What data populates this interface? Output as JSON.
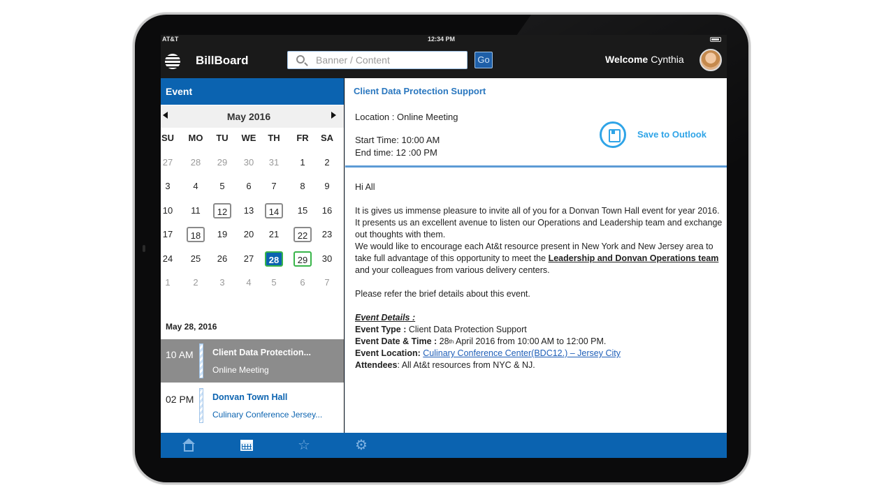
{
  "status_bar": {
    "carrier": "AT&T",
    "time": "12:34 PM"
  },
  "header": {
    "brand": "BillBoard",
    "search_placeholder": "Banner / Content",
    "go_label": "Go",
    "welcome": "Welcome",
    "user_name": "Cynthia"
  },
  "left_panel": {
    "title": "Event",
    "month": "May 2016",
    "weekdays": [
      "SU",
      "MO",
      "TU",
      "WE",
      "TH",
      "FR",
      "SA"
    ],
    "weeks": [
      [
        {
          "d": "27",
          "s": "muted"
        },
        {
          "d": "28",
          "s": "muted"
        },
        {
          "d": "29",
          "s": "muted"
        },
        {
          "d": "30",
          "s": "muted"
        },
        {
          "d": "31",
          "s": "muted"
        },
        {
          "d": "1",
          "s": ""
        },
        {
          "d": "2",
          "s": ""
        }
      ],
      [
        {
          "d": "3",
          "s": ""
        },
        {
          "d": "4",
          "s": ""
        },
        {
          "d": "5",
          "s": ""
        },
        {
          "d": "6",
          "s": ""
        },
        {
          "d": "7",
          "s": ""
        },
        {
          "d": "8",
          "s": ""
        },
        {
          "d": "9",
          "s": ""
        }
      ],
      [
        {
          "d": "10",
          "s": ""
        },
        {
          "d": "11",
          "s": ""
        },
        {
          "d": "12",
          "s": "ev"
        },
        {
          "d": "13",
          "s": ""
        },
        {
          "d": "14",
          "s": "ev"
        },
        {
          "d": "15",
          "s": ""
        },
        {
          "d": "16",
          "s": ""
        }
      ],
      [
        {
          "d": "17",
          "s": ""
        },
        {
          "d": "18",
          "s": "ev"
        },
        {
          "d": "19",
          "s": ""
        },
        {
          "d": "20",
          "s": ""
        },
        {
          "d": "21",
          "s": ""
        },
        {
          "d": "22",
          "s": "ev"
        },
        {
          "d": "23",
          "s": ""
        }
      ],
      [
        {
          "d": "24",
          "s": ""
        },
        {
          "d": "25",
          "s": ""
        },
        {
          "d": "26",
          "s": ""
        },
        {
          "d": "27",
          "s": ""
        },
        {
          "d": "28",
          "s": "sel"
        },
        {
          "d": "29",
          "s": "next"
        },
        {
          "d": "30",
          "s": ""
        }
      ],
      [
        {
          "d": "1",
          "s": "muted"
        },
        {
          "d": "2",
          "s": "muted"
        },
        {
          "d": "3",
          "s": "muted"
        },
        {
          "d": "4",
          "s": "muted"
        },
        {
          "d": "5",
          "s": "muted"
        },
        {
          "d": "6",
          "s": "muted"
        },
        {
          "d": "7",
          "s": "muted"
        }
      ]
    ],
    "selected_date": "May 28, 2016",
    "events": [
      {
        "time": "10 AM",
        "title": "Client Data Protection...",
        "subtitle": "Online Meeting",
        "active": true
      },
      {
        "time": "02 PM",
        "title": "Donvan Town Hall",
        "subtitle": "Culinary Conference Jersey...",
        "active": false
      }
    ]
  },
  "detail": {
    "title": "Client Data Protection Support",
    "location": "Location  :  Online Meeting",
    "start": "Start Time: 10:00 AM",
    "end": "End time:   12 :00 PM",
    "save_label": "Save to Outlook",
    "greeting": "Hi All",
    "para1_a": "It is gives us immense pleasure to invite all of you for a Donvan Town Hall event for year 2016. It presents us an excellent avenue  to listen our Operations and Leadership team and exchange out thoughts with them.",
    "para1_b": "We would like to encourage each At&t resource present in New York and New Jersey area to take full advantage of this opportunity to meet the ",
    "para1_hl": " Leadership and Donvan Operations team",
    "para1_c": " and your colleagues from various delivery centers.",
    "para2": "Please refer the brief details about this event.",
    "details_title": "Event Details :",
    "type_label": "Event Type : ",
    "type_value": "Client Data Protection Support",
    "date_label": "Event Date & Time : ",
    "date_value_a": "28",
    "date_value_sup": "th",
    "date_value_b": " April 2016 from 10:00 AM to 12:00 PM.",
    "loc_label": "Event Location: ",
    "loc_value": "Culinary Conference Center(BDC12.) – Jersey City",
    "att_label": "Attendees",
    "att_value": ": All At&t resources from NYC & NJ."
  },
  "bottom_tabs": [
    "home-icon",
    "calendar-icon",
    "star-icon",
    "gear-icon"
  ],
  "colors": {
    "primary": "#0b63b0",
    "accent": "#2fa4e7",
    "selected_outline": "#39b54a"
  }
}
